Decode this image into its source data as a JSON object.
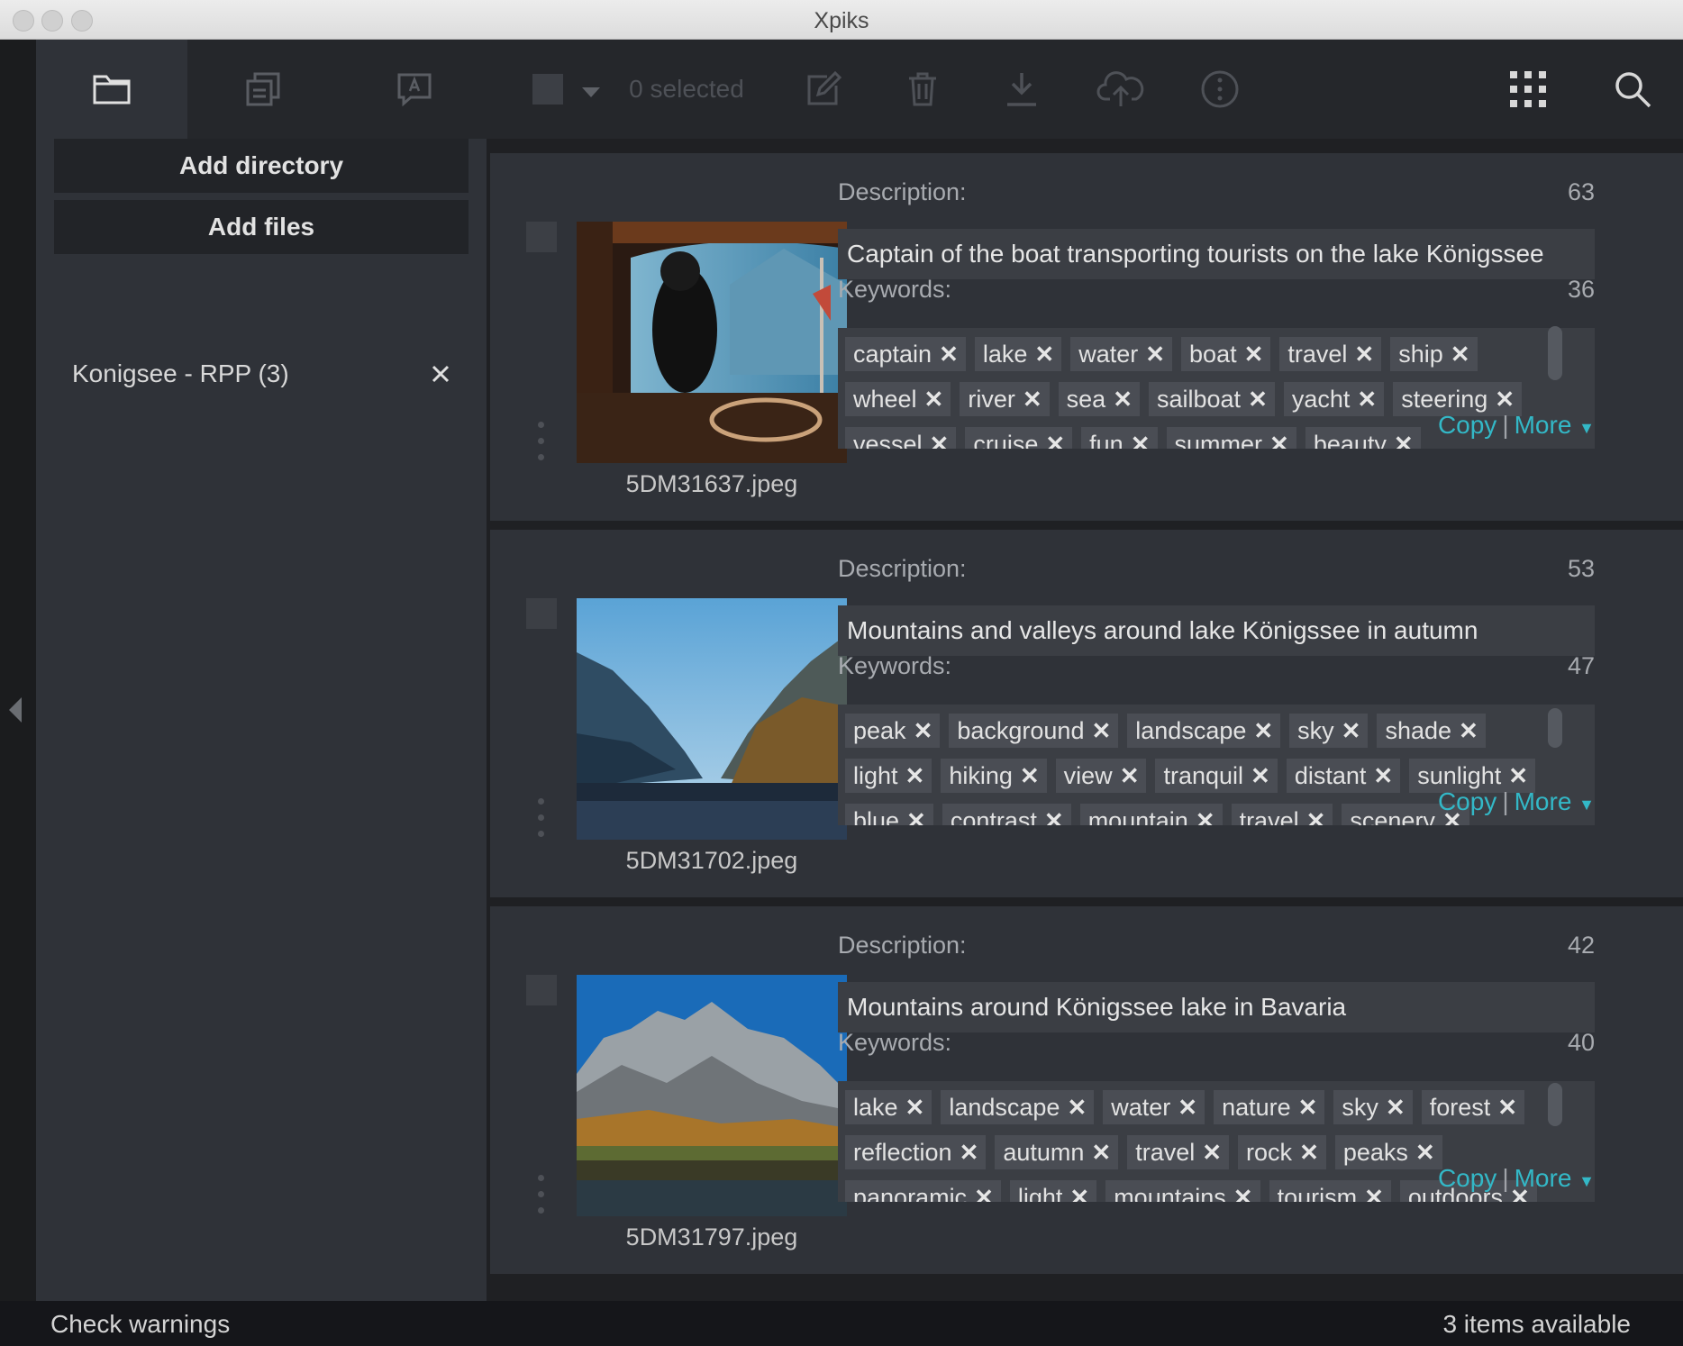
{
  "window": {
    "title": "Xpiks"
  },
  "sidebar": {
    "tabs": [
      {
        "icon": "folder-icon"
      },
      {
        "icon": "copy-files-icon"
      },
      {
        "icon": "translate-icon"
      }
    ],
    "add_directory_label": "Add directory",
    "add_files_label": "Add files",
    "directories": [
      {
        "name": "Konigsee - RPP (3)"
      }
    ]
  },
  "toolbar": {
    "selected_label": "0 selected",
    "icons": [
      "select-checkbox-icon",
      "chevron-down-icon",
      "edit-icon",
      "trash-icon",
      "download-icon",
      "upload-cloud-icon",
      "info-icon",
      "grid-view-icon",
      "search-icon"
    ]
  },
  "artworks": [
    {
      "filename": "5DM31637.jpeg",
      "description_label": "Description:",
      "description_count": "63",
      "description": "Captain of the boat transporting tourists on the lake Königssee",
      "keywords_label": "Keywords:",
      "keywords_count": "36",
      "keywords": [
        "captain",
        "lake",
        "water",
        "boat",
        "travel",
        "ship",
        "wheel",
        "river",
        "sea",
        "sailboat",
        "yacht",
        "steering",
        "vessel",
        "cruise",
        "fun",
        "summer",
        "beauty"
      ],
      "copy_label": "Copy",
      "more_label": "More"
    },
    {
      "filename": "5DM31702.jpeg",
      "description_label": "Description:",
      "description_count": "53",
      "description": "Mountains and valleys around lake Königssee in autumn",
      "keywords_label": "Keywords:",
      "keywords_count": "47",
      "keywords": [
        "peak",
        "background",
        "landscape",
        "sky",
        "shade",
        "light",
        "hiking",
        "view",
        "tranquil",
        "distant",
        "sunlight",
        "blue",
        "contrast",
        "mountain",
        "travel",
        "scenery"
      ],
      "copy_label": "Copy",
      "more_label": "More"
    },
    {
      "filename": "5DM31797.jpeg",
      "description_label": "Description:",
      "description_count": "42",
      "description": "Mountains around Königssee lake in Bavaria",
      "keywords_label": "Keywords:",
      "keywords_count": "40",
      "keywords": [
        "lake",
        "landscape",
        "water",
        "nature",
        "sky",
        "forest",
        "reflection",
        "autumn",
        "travel",
        "rock",
        "peaks",
        "panoramic",
        "light",
        "mountains",
        "tourism",
        "outdoors"
      ],
      "copy_label": "Copy",
      "more_label": "More"
    }
  ],
  "status": {
    "warnings_label": "Check warnings",
    "items_label": "3 items available"
  },
  "colors": {
    "accent": "#33b8c7",
    "panel": "#2f3238",
    "toolbar": "#25272b"
  }
}
